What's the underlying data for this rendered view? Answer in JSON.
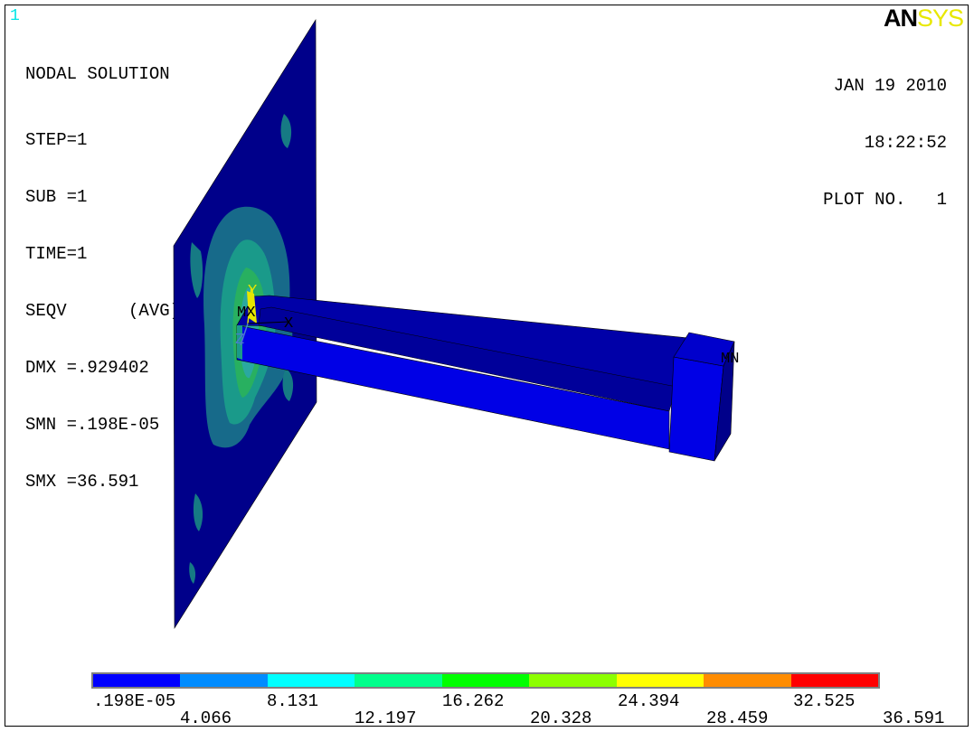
{
  "window": {
    "number": "1",
    "background": "#ffffff"
  },
  "info": {
    "title": "NODAL SOLUTION",
    "lines": [
      "STEP=1",
      "SUB =1",
      "TIME=1",
      "SEQV      (AVG)",
      "DMX =.929402",
      "SMN =.198E-05",
      "SMX =36.591"
    ]
  },
  "stamp": {
    "date": "JAN 19 2010",
    "time": "18:22:52",
    "plot": "PLOT NO.   1"
  },
  "logo": {
    "part1": "AN",
    "part2": "SYS",
    "color1": "#000000",
    "color2": "#e8e800"
  },
  "triad": {
    "x": "X",
    "y": "Y",
    "z": "Z",
    "mx": "MX",
    "mn": "MN"
  },
  "legend": {
    "colors": [
      "#0000ff",
      "#008cff",
      "#00ffff",
      "#00ff8c",
      "#00ff00",
      "#8cff00",
      "#ffff00",
      "#ff8c00",
      "#ff0000"
    ],
    "upper_labels": [
      ".198E-05",
      "8.131",
      "16.262",
      "24.394",
      "32.525"
    ],
    "lower_labels": [
      "4.066",
      "12.197",
      "20.328",
      "28.459",
      "36.591"
    ]
  }
}
